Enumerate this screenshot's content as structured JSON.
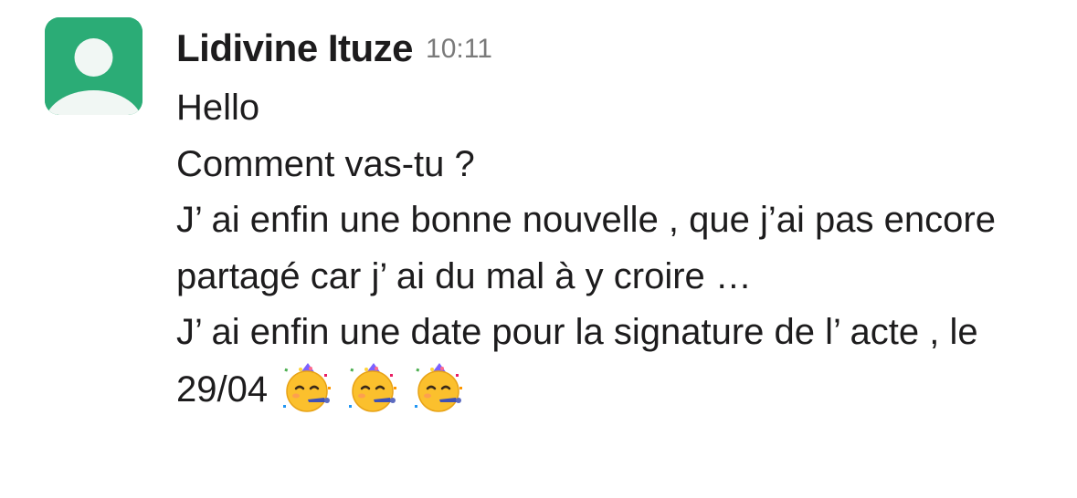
{
  "message": {
    "avatar_icon": "default-user-avatar",
    "avatar_color": "#2bac76",
    "sender": "Lidivine Ituze",
    "timestamp": "10:11",
    "lines": [
      "Hello",
      "Comment vas-tu ?",
      "J’ ai enfin une bonne nouvelle , que j’ai pas encore partagé car j’ ai du mal à y croire …",
      "J’ ai enfin une date pour la signature de l’ acte , le 29/04"
    ],
    "emojis": [
      "partying-face",
      "partying-face",
      "partying-face"
    ]
  }
}
